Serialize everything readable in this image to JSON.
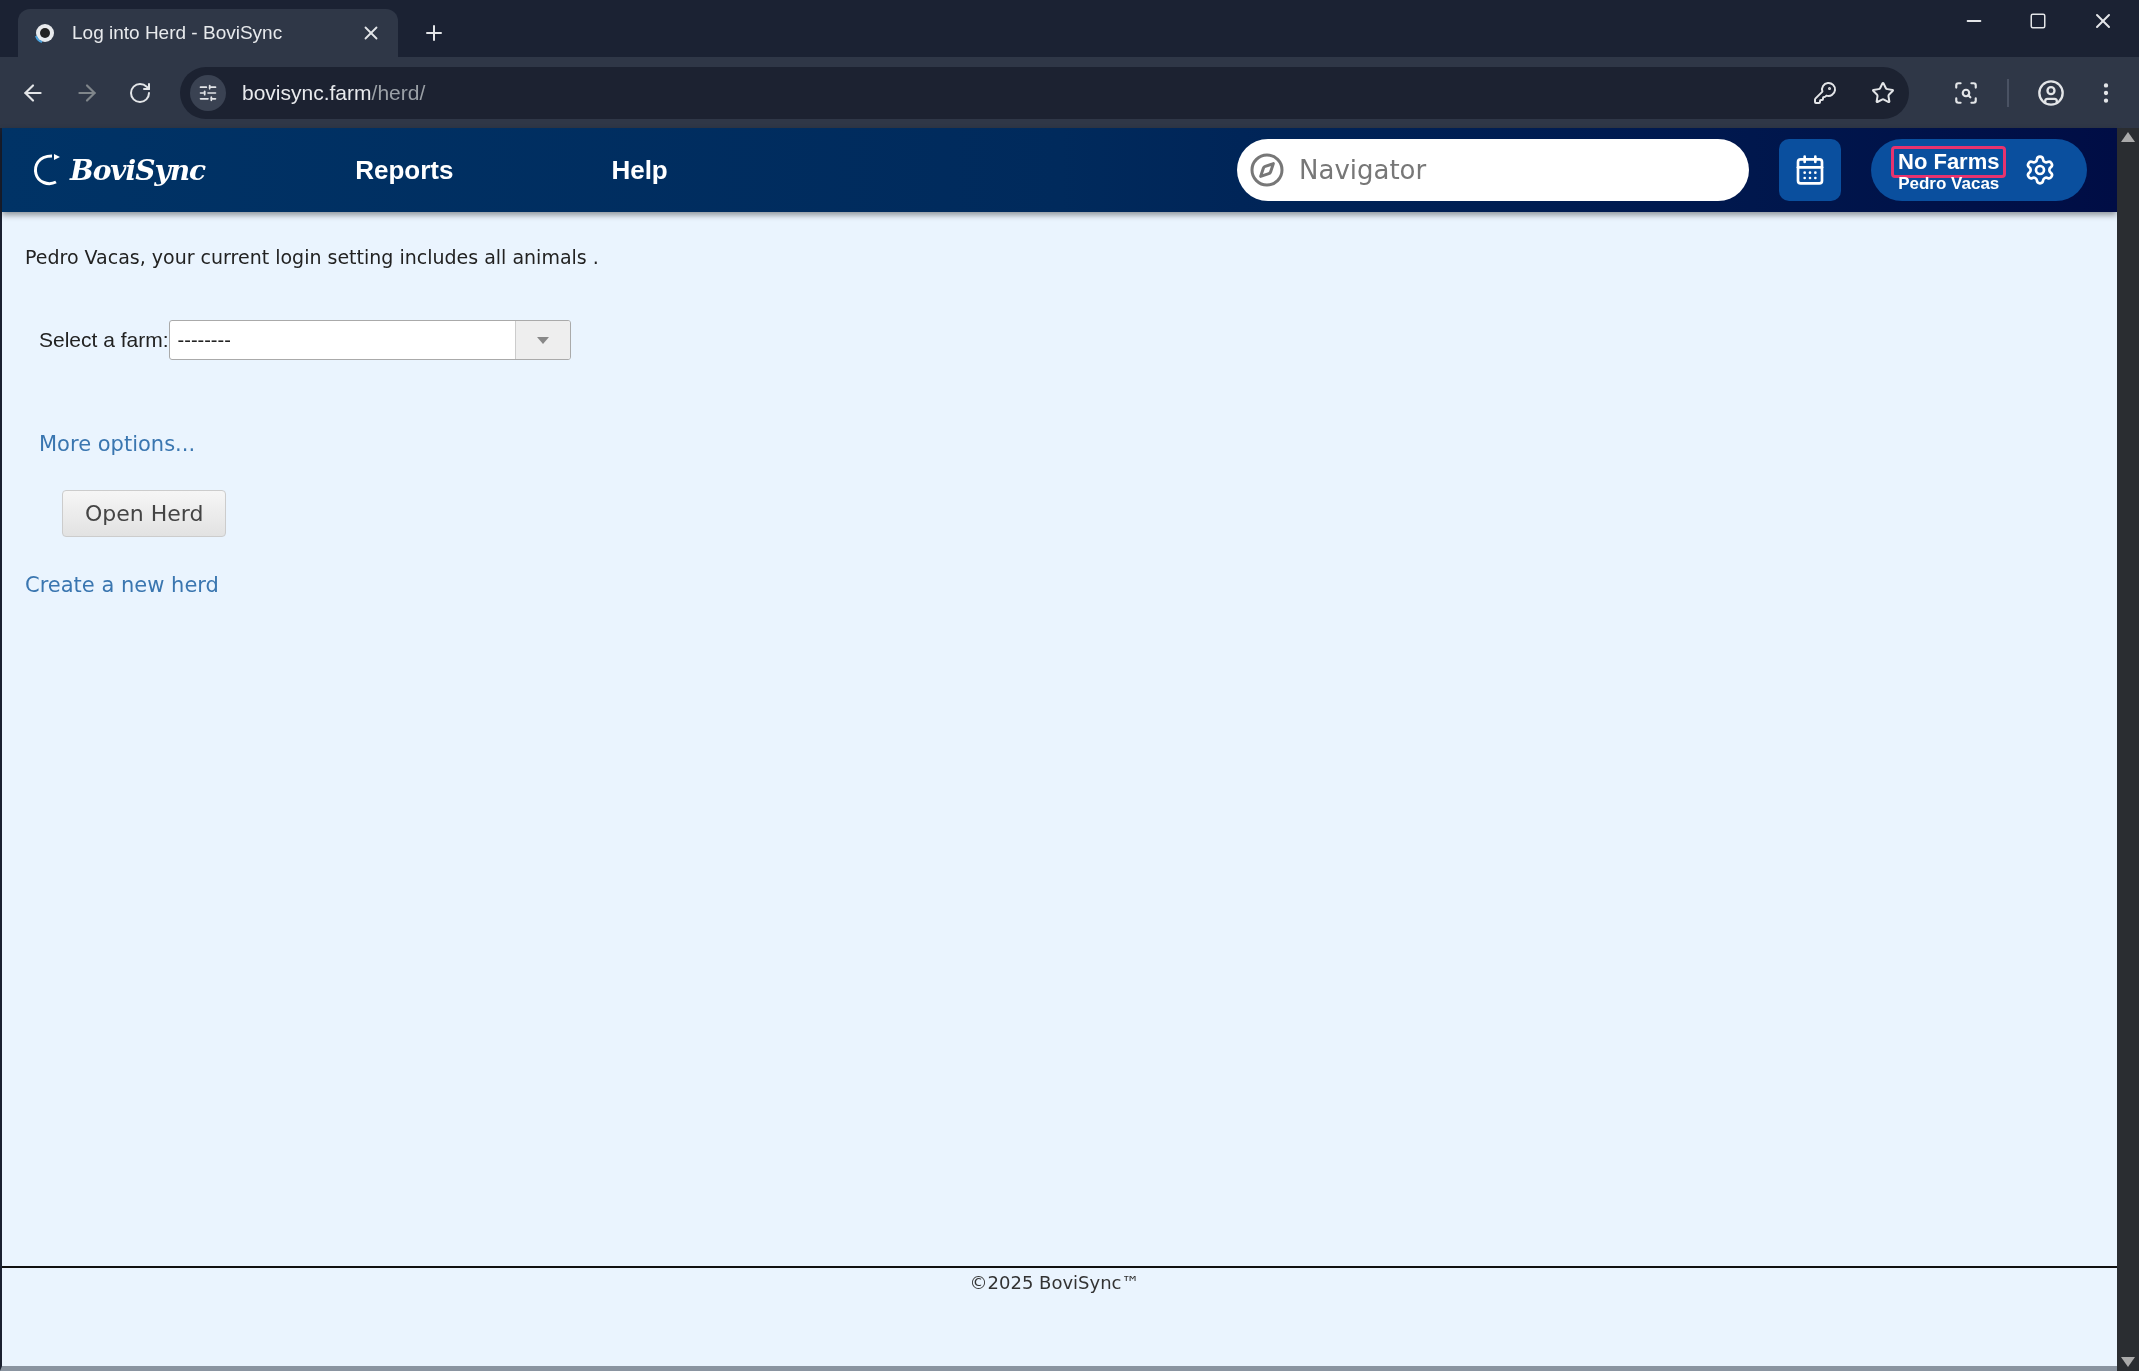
{
  "browser": {
    "tab": {
      "title": "Log into Herd - BoviSync"
    },
    "address": {
      "host": "bovisync.farm",
      "path": "/herd/"
    }
  },
  "header": {
    "logo": "BoviSync",
    "nav": [
      {
        "label": "Reports"
      },
      {
        "label": "Help"
      }
    ],
    "navigator": {
      "placeholder": "Navigator"
    },
    "account": {
      "farm": "No Farms",
      "farm_highlighted": true,
      "user": "Pedro Vacas"
    }
  },
  "content": {
    "message": "Pedro Vacas, your current login setting includes all animals .",
    "farm_select": {
      "label": "Select a farm:",
      "value": "--------"
    },
    "more_options": "More options...",
    "open_button": "Open Herd",
    "create_link": "Create a new herd"
  },
  "footer": {
    "text": "©2025 BoviSync™"
  }
}
